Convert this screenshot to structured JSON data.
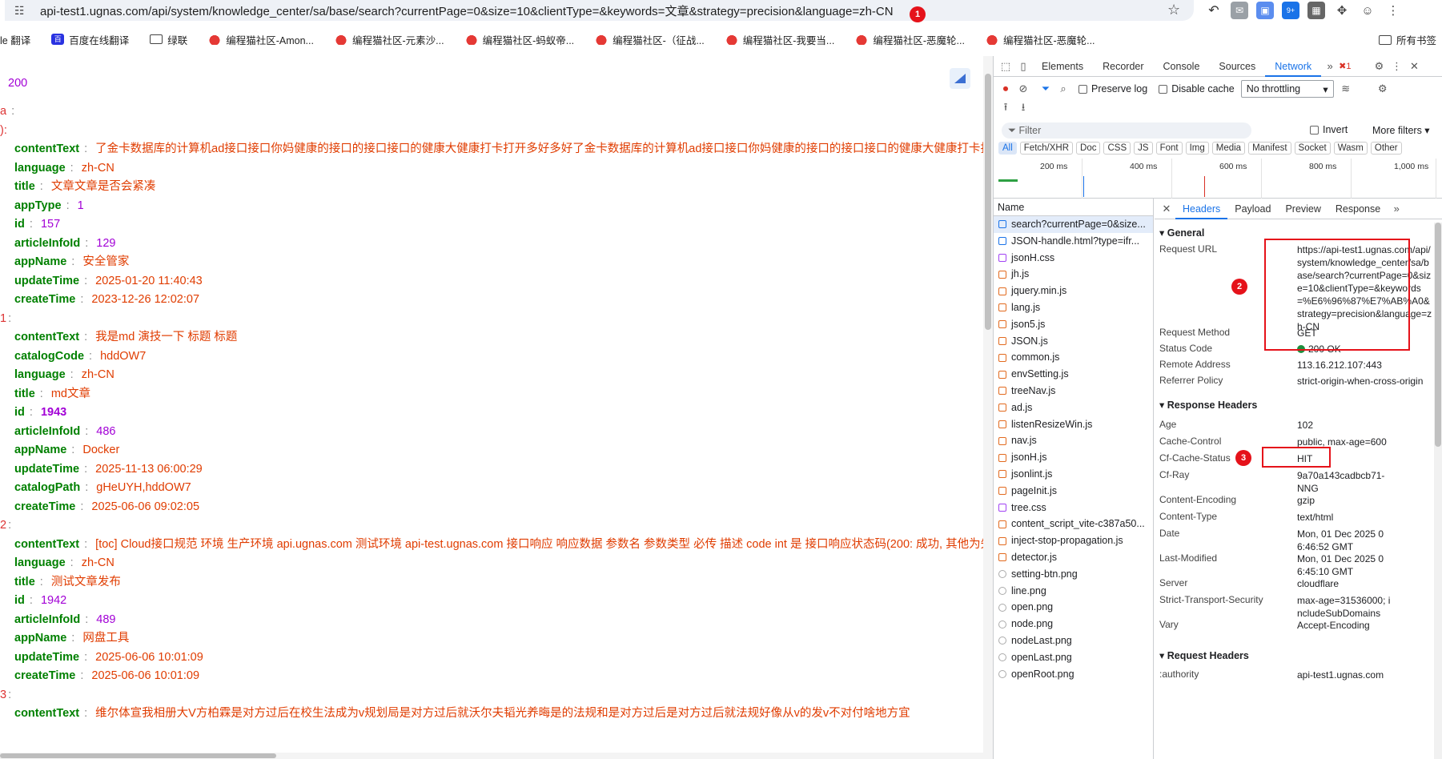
{
  "browser": {
    "url": "api-test1.ugnas.com/api/system/knowledge_center/sa/base/search?currentPage=0&size=10&clientType=&keywords=文章&strategy=precision&language=zh-CN",
    "url_badge": "1",
    "ext_badge": "9+"
  },
  "bookmarks": [
    "le 翻译",
    "百度在线翻译",
    "绿联",
    "编程猫社区-Amon...",
    "编程猫社区-元素沙...",
    "编程猫社区-蚂蚁帝...",
    "编程猫社区-（征战...",
    "编程猫社区-我要当...",
    "编程猫社区-恶魔轮...",
    "编程猫社区-恶魔轮..."
  ],
  "all_bookmarks": "所有书签",
  "json": {
    "code": "200",
    "data_key": "a",
    "list_open": "):",
    "items": [
      {
        "index": "0",
        "fields": [
          {
            "k": "contentText",
            "v": "了金卡数据库的计算机ad接口接口你妈健康的接口的接口接口的健康大健康打卡打开多好多好了金卡数据库的计算机ad接口接口你妈健康的接口的接口接口的健康大健康打卡打开多",
            "t": "s"
          },
          {
            "k": "language",
            "v": "zh-CN",
            "t": "s"
          },
          {
            "k": "title",
            "v": "文章文章是否会紧凑",
            "t": "s"
          },
          {
            "k": "appType",
            "v": "1",
            "t": "n"
          },
          {
            "k": "id",
            "v": "157",
            "t": "n"
          },
          {
            "k": "articleInfoId",
            "v": "129",
            "t": "n"
          },
          {
            "k": "appName",
            "v": "安全管家",
            "t": "s"
          },
          {
            "k": "updateTime",
            "v": "2025-01-20 11:40:43",
            "t": "s"
          },
          {
            "k": "createTime",
            "v": "2023-12-26 12:02:07",
            "t": "s"
          }
        ]
      },
      {
        "index": "1",
        "fields": [
          {
            "k": "contentText",
            "v": "我是md 演技一下 标题 标题",
            "t": "s"
          },
          {
            "k": "catalogCode",
            "v": "hddOW7",
            "t": "s"
          },
          {
            "k": "language",
            "v": "zh-CN",
            "t": "s"
          },
          {
            "k": "title",
            "v": "md文章",
            "t": "s"
          },
          {
            "k": "id",
            "v": "1943",
            "t": "nb"
          },
          {
            "k": "articleInfoId",
            "v": "486",
            "t": "n"
          },
          {
            "k": "appName",
            "v": "Docker",
            "t": "s"
          },
          {
            "k": "updateTime",
            "v": "2025-11-13 06:00:29",
            "t": "s"
          },
          {
            "k": "catalogPath",
            "v": "gHeUYH,hddOW7",
            "t": "s"
          },
          {
            "k": "createTime",
            "v": "2025-06-06 09:02:05",
            "t": "s"
          }
        ]
      },
      {
        "index": "2",
        "fields": [
          {
            "k": "contentText",
            "v": "[toc] Cloud接口规范 环境 生产环境 api.ugnas.com 测试环境 api-test.ugnas.com 接口响应 响应数据 参数名 参数类型 必传 描述 code int 是 接口响应状态码(200: 成功, 其他为失败",
            "t": "s"
          },
          {
            "k": "language",
            "v": "zh-CN",
            "t": "s"
          },
          {
            "k": "title",
            "v": "测试文章发布",
            "t": "s"
          },
          {
            "k": "id",
            "v": "1942",
            "t": "n"
          },
          {
            "k": "articleInfoId",
            "v": "489",
            "t": "n"
          },
          {
            "k": "appName",
            "v": "网盘工具",
            "t": "s"
          },
          {
            "k": "updateTime",
            "v": "2025-06-06 10:01:09",
            "t": "s"
          },
          {
            "k": "createTime",
            "v": "2025-06-06 10:01:09",
            "t": "s"
          }
        ]
      },
      {
        "index": "3",
        "fields": [
          {
            "k": "contentText",
            "v": "维尔体宣我相册大V方柏霖是对方过后在校生法成为v规划局是对方过后就沃尔夫韬光养晦是的法规和是对方过后是对方过后就法规好像从v的发v不对付啥地方宜",
            "t": "s"
          }
        ]
      }
    ]
  },
  "devtools": {
    "tabs": [
      "Elements",
      "Recorder",
      "Console",
      "Sources",
      "Network"
    ],
    "active_tab": "Network",
    "error_count": "1",
    "preserve_log": "Preserve log",
    "disable_cache": "Disable cache",
    "throttle": "No throttling",
    "filter_placeholder": "Filter",
    "invert": "Invert",
    "more_filters": "More filters",
    "types": [
      "All",
      "Fetch/XHR",
      "Doc",
      "CSS",
      "JS",
      "Font",
      "Img",
      "Media",
      "Manifest",
      "Socket",
      "Wasm",
      "Other"
    ],
    "timeline_ticks": [
      "200 ms",
      "400 ms",
      "600 ms",
      "800 ms",
      "1,000 ms"
    ],
    "name_header": "Name",
    "files": [
      {
        "n": "search?currentPage=0&size...",
        "t": "doc"
      },
      {
        "n": "JSON-handle.html?type=ifr...",
        "t": "doc"
      },
      {
        "n": "jsonH.css",
        "t": "css"
      },
      {
        "n": "jh.js",
        "t": "js"
      },
      {
        "n": "jquery.min.js",
        "t": "js"
      },
      {
        "n": "lang.js",
        "t": "js"
      },
      {
        "n": "json5.js",
        "t": "js"
      },
      {
        "n": "JSON.js",
        "t": "js"
      },
      {
        "n": "common.js",
        "t": "js"
      },
      {
        "n": "envSetting.js",
        "t": "js"
      },
      {
        "n": "treeNav.js",
        "t": "js"
      },
      {
        "n": "ad.js",
        "t": "js"
      },
      {
        "n": "listenResizeWin.js",
        "t": "js"
      },
      {
        "n": "nav.js",
        "t": "js"
      },
      {
        "n": "jsonH.js",
        "t": "js"
      },
      {
        "n": "jsonlint.js",
        "t": "js"
      },
      {
        "n": "pageInit.js",
        "t": "js"
      },
      {
        "n": "tree.css",
        "t": "css"
      },
      {
        "n": "content_script_vite-c387a50...",
        "t": "js"
      },
      {
        "n": "inject-stop-propagation.js",
        "t": "js"
      },
      {
        "n": "detector.js",
        "t": "js"
      },
      {
        "n": "setting-btn.png",
        "t": "img"
      },
      {
        "n": "line.png",
        "t": "img"
      },
      {
        "n": "open.png",
        "t": "img"
      },
      {
        "n": "node.png",
        "t": "img"
      },
      {
        "n": "nodeLast.png",
        "t": "img"
      },
      {
        "n": "openLast.png",
        "t": "img"
      },
      {
        "n": "openRoot.png",
        "t": "img"
      }
    ],
    "detail_tabs": [
      "Headers",
      "Payload",
      "Preview",
      "Response"
    ],
    "general": {
      "title": "General",
      "request_url_k": "Request URL",
      "request_url_v": "https://api-test1.ugnas.com/api/system/knowledge_center/sa/base/search?currentPage=0&size=10&clientType=&keywords=%E6%96%87%E7%AB%A0&strategy=precision&language=zh-CN",
      "method_k": "Request Method",
      "method_v": "GET",
      "status_k": "Status Code",
      "status_v": "200 OK",
      "remote_k": "Remote Address",
      "remote_v": "113.16.212.107:443",
      "referrer_k": "Referrer Policy",
      "referrer_v": "strict-origin-when-cross-origin"
    },
    "response_headers_title": "Response Headers",
    "response_headers": [
      {
        "k": "Age",
        "v": "102"
      },
      {
        "k": "Cache-Control",
        "v": "public, max-age=600"
      },
      {
        "k": "Cf-Cache-Status",
        "v": "HIT"
      },
      {
        "k": "Cf-Ray",
        "v": "9a70a143cadbcb71-NNG"
      },
      {
        "k": "Content-Encoding",
        "v": "gzip"
      },
      {
        "k": "Content-Type",
        "v": "text/html"
      },
      {
        "k": "Date",
        "v": "Mon, 01 Dec 2025 06:46:52 GMT"
      },
      {
        "k": "Last-Modified",
        "v": "Mon, 01 Dec 2025 06:45:10 GMT"
      },
      {
        "k": "Server",
        "v": "cloudflare"
      },
      {
        "k": "Strict-Transport-Security",
        "v": "max-age=31536000; includeSubDomains"
      },
      {
        "k": "Vary",
        "v": "Accept-Encoding"
      }
    ],
    "request_headers_title": "Request Headers",
    "request_headers": [
      {
        "k": ":authority",
        "v": "api-test1.ugnas.com"
      }
    ],
    "markers": [
      "2",
      "3"
    ]
  }
}
